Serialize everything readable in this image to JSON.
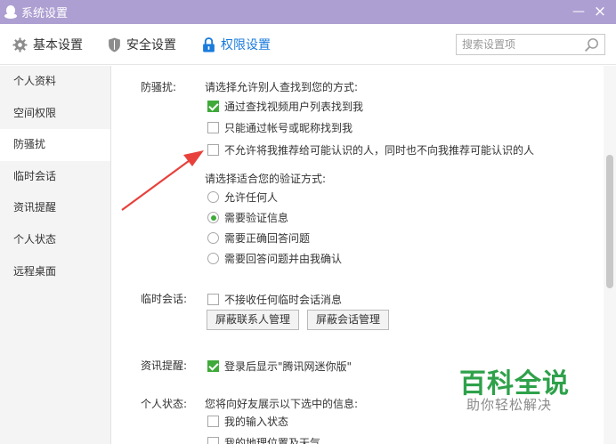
{
  "window": {
    "title": "系统设置",
    "minimize": "—",
    "close": "×"
  },
  "tabs": [
    {
      "label": "基本设置",
      "icon": "gear-icon"
    },
    {
      "label": "安全设置",
      "icon": "shield-icon"
    },
    {
      "label": "权限设置",
      "icon": "lock-icon",
      "active": true
    }
  ],
  "search": {
    "placeholder": "搜索设置项",
    "value": ""
  },
  "sidebar": {
    "items": [
      {
        "label": "个人资料"
      },
      {
        "label": "空间权限"
      },
      {
        "label": "防骚扰",
        "active": true
      },
      {
        "label": "临时会话"
      },
      {
        "label": "资讯提醒"
      },
      {
        "label": "个人状态"
      },
      {
        "label": "远程桌面"
      }
    ]
  },
  "harassment": {
    "label": "防骚扰:",
    "find_prompt": "请选择允许别人查找到您的方式:",
    "find_options": [
      {
        "label": "通过查找视频用户列表找到我",
        "checked": true
      },
      {
        "label": "只能通过帐号或昵称找到我",
        "checked": false
      },
      {
        "label": "不允许将我推荐给可能认识的人，同时也不向我推荐可能认识的人",
        "checked": false
      }
    ],
    "verify_prompt": "请选择适合您的验证方式:",
    "verify_options": [
      {
        "label": "允许任何人",
        "selected": false
      },
      {
        "label": "需要验证信息",
        "selected": true
      },
      {
        "label": "需要正确回答问题",
        "selected": false
      },
      {
        "label": "需要回答问题并由我确认",
        "selected": false
      }
    ]
  },
  "temp_chat": {
    "label": "临时会话:",
    "option": {
      "label": "不接收任何临时会话消息",
      "checked": false
    },
    "buttons": {
      "block_contacts": "屏蔽联系人管理",
      "block_sessions": "屏蔽会话管理"
    }
  },
  "news": {
    "label": "资讯提醒:",
    "option": {
      "label": "登录后显示\"腾讯网迷你版\"",
      "checked": true
    }
  },
  "status": {
    "label": "个人状态:",
    "prompt": "您将向好友展示以下选中的信息:",
    "options": [
      {
        "label": "我的输入状态",
        "checked": false
      },
      {
        "label": "我的地理位置及天气",
        "checked": false
      }
    ]
  },
  "watermark": {
    "title": "百科全说",
    "subtitle": "助你轻松解决"
  },
  "colors": {
    "titlebar": "#ad9fd2",
    "accent": "#1a7bdc",
    "check": "#3faa3a",
    "arrow": "#e8413c",
    "watermark": "#2ea14a"
  }
}
